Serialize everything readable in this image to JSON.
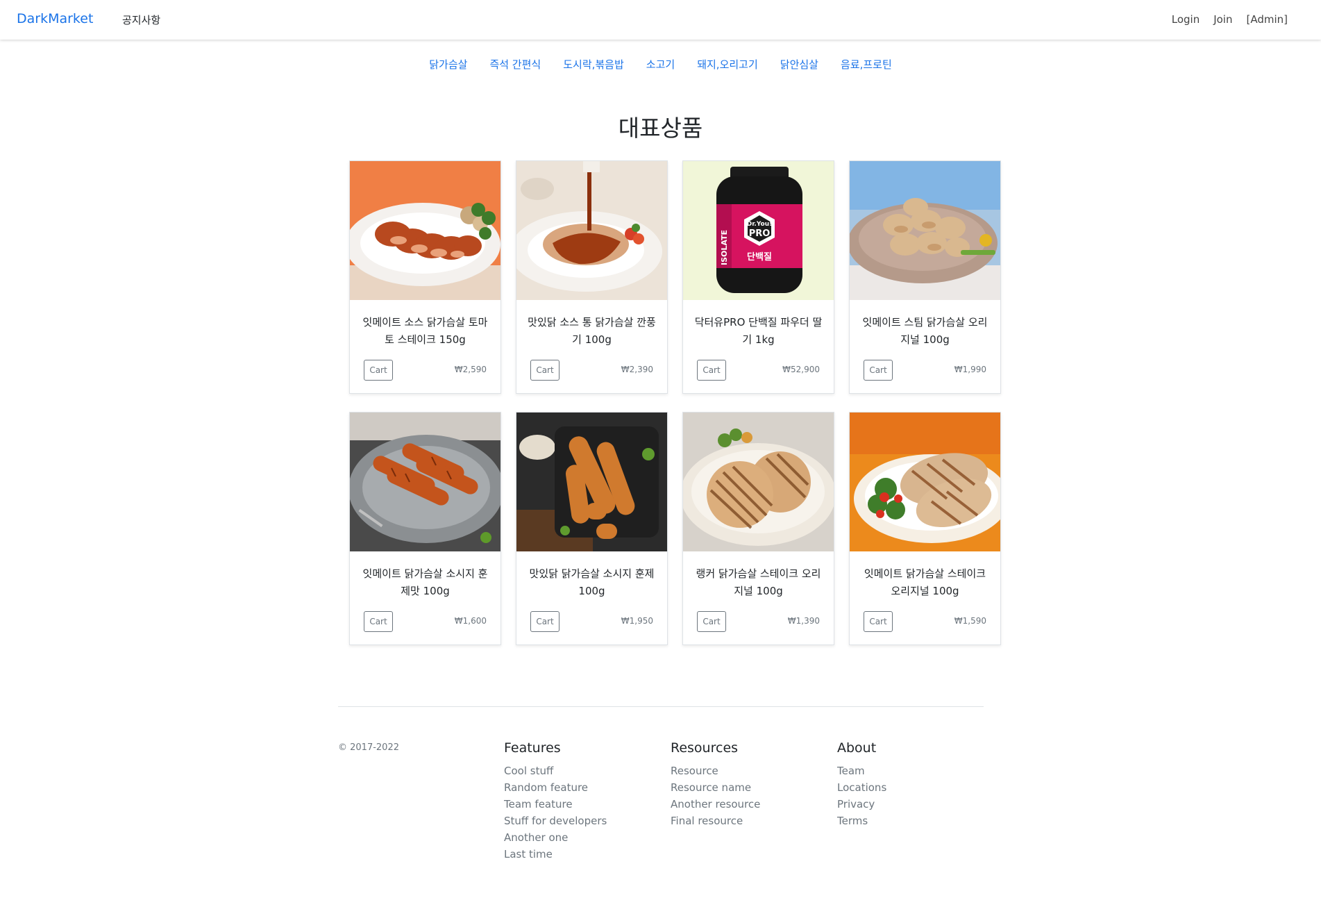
{
  "navbar": {
    "brand": "DarkMarket",
    "notice": "공지사항",
    "login": "Login",
    "join": "Join",
    "admin": "[Admin]"
  },
  "categories": [
    "닭가슴살",
    "즉석 간편식",
    "도시락,볶음밥",
    "소고기",
    "돼지,오리고기",
    "닭안심살",
    "음료,프로틴"
  ],
  "section_title": "대표상품",
  "products": [
    {
      "name": "잇메이트 소스 닭가슴살 토마토 스테이크 150g",
      "cart": "Cart",
      "price": "₩2,590"
    },
    {
      "name": "맛있닭 소스 통 닭가슴살 깐풍기 100g",
      "cart": "Cart",
      "price": "₩2,390"
    },
    {
      "name": "닥터유PRO 단백질 파우더 딸기 1kg",
      "cart": "Cart",
      "price": "₩52,900"
    },
    {
      "name": "잇메이트 스팀 닭가슴살 오리지널 100g",
      "cart": "Cart",
      "price": "₩1,990"
    },
    {
      "name": "잇메이트 닭가슴살 소시지 훈제맛 100g",
      "cart": "Cart",
      "price": "₩1,600"
    },
    {
      "name": "맛있닭 닭가슴살 소시지 훈제 100g",
      "cart": "Cart",
      "price": "₩1,950"
    },
    {
      "name": "랭커 닭가슴살 스테이크 오리지널 100g",
      "cart": "Cart",
      "price": "₩1,390"
    },
    {
      "name": "잇메이트 닭가슴살 스테이크 오리지널 100g",
      "cart": "Cart",
      "price": "₩1,590"
    }
  ],
  "product_images": {
    "jar_brand": "Dr.You!",
    "jar_product": "PRO",
    "jar_kor": "단백질",
    "jar_side": "ISOLATE"
  },
  "footer": {
    "copyright": "© 2017-2022",
    "features": {
      "title": "Features",
      "items": [
        "Cool stuff",
        "Random feature",
        "Team feature",
        "Stuff for developers",
        "Another one",
        "Last time"
      ]
    },
    "resources": {
      "title": "Resources",
      "items": [
        "Resource",
        "Resource name",
        "Another resource",
        "Final resource"
      ]
    },
    "about": {
      "title": "About",
      "items": [
        "Team",
        "Locations",
        "Privacy",
        "Terms"
      ]
    }
  },
  "colors": {
    "link": "#1a73e8",
    "muted": "#6c757d",
    "border": "#dee2e6"
  }
}
